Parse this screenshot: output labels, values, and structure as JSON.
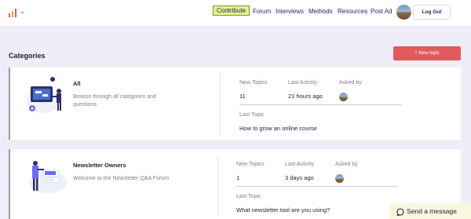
{
  "header": {
    "nav": [
      {
        "label": "Contribute"
      },
      {
        "label": "Forum"
      },
      {
        "label": "Interviews"
      },
      {
        "label": "Methods"
      },
      {
        "label": "Resources"
      },
      {
        "label": "Post Ad"
      }
    ],
    "logout_label": "Log Out"
  },
  "main": {
    "section_title": "Categories",
    "new_topic_label": "+ New topic",
    "categories": [
      {
        "title": "All",
        "description": "Browse through all categories and questions",
        "new_topics_label": "New Topics",
        "new_topics": "11",
        "last_activity_label": "Last Activity",
        "last_activity": "21 hours ago",
        "asked_by_label": "Asked by",
        "last_topic_label": "Last Topic",
        "last_topic": "How to grow an online course"
      },
      {
        "title": "Newsletter Owners",
        "description": "Welcome to the Newsletter Q&A Forum",
        "new_topics_label": "New Topics",
        "new_topics": "1",
        "last_activity_label": "Last Activity",
        "last_activity": "3 days ago",
        "asked_by_label": "Asked by",
        "last_topic_label": "Last Topic",
        "last_topic": "What newsletter tool are you using?"
      }
    ]
  },
  "chat_widget": {
    "label": "Send a message"
  },
  "colors": {
    "accent_red": "#e25b5b",
    "nav_text": "#1c1f66",
    "contribute_highlight": "#e3f38a",
    "page_bg": "#efeef8"
  }
}
